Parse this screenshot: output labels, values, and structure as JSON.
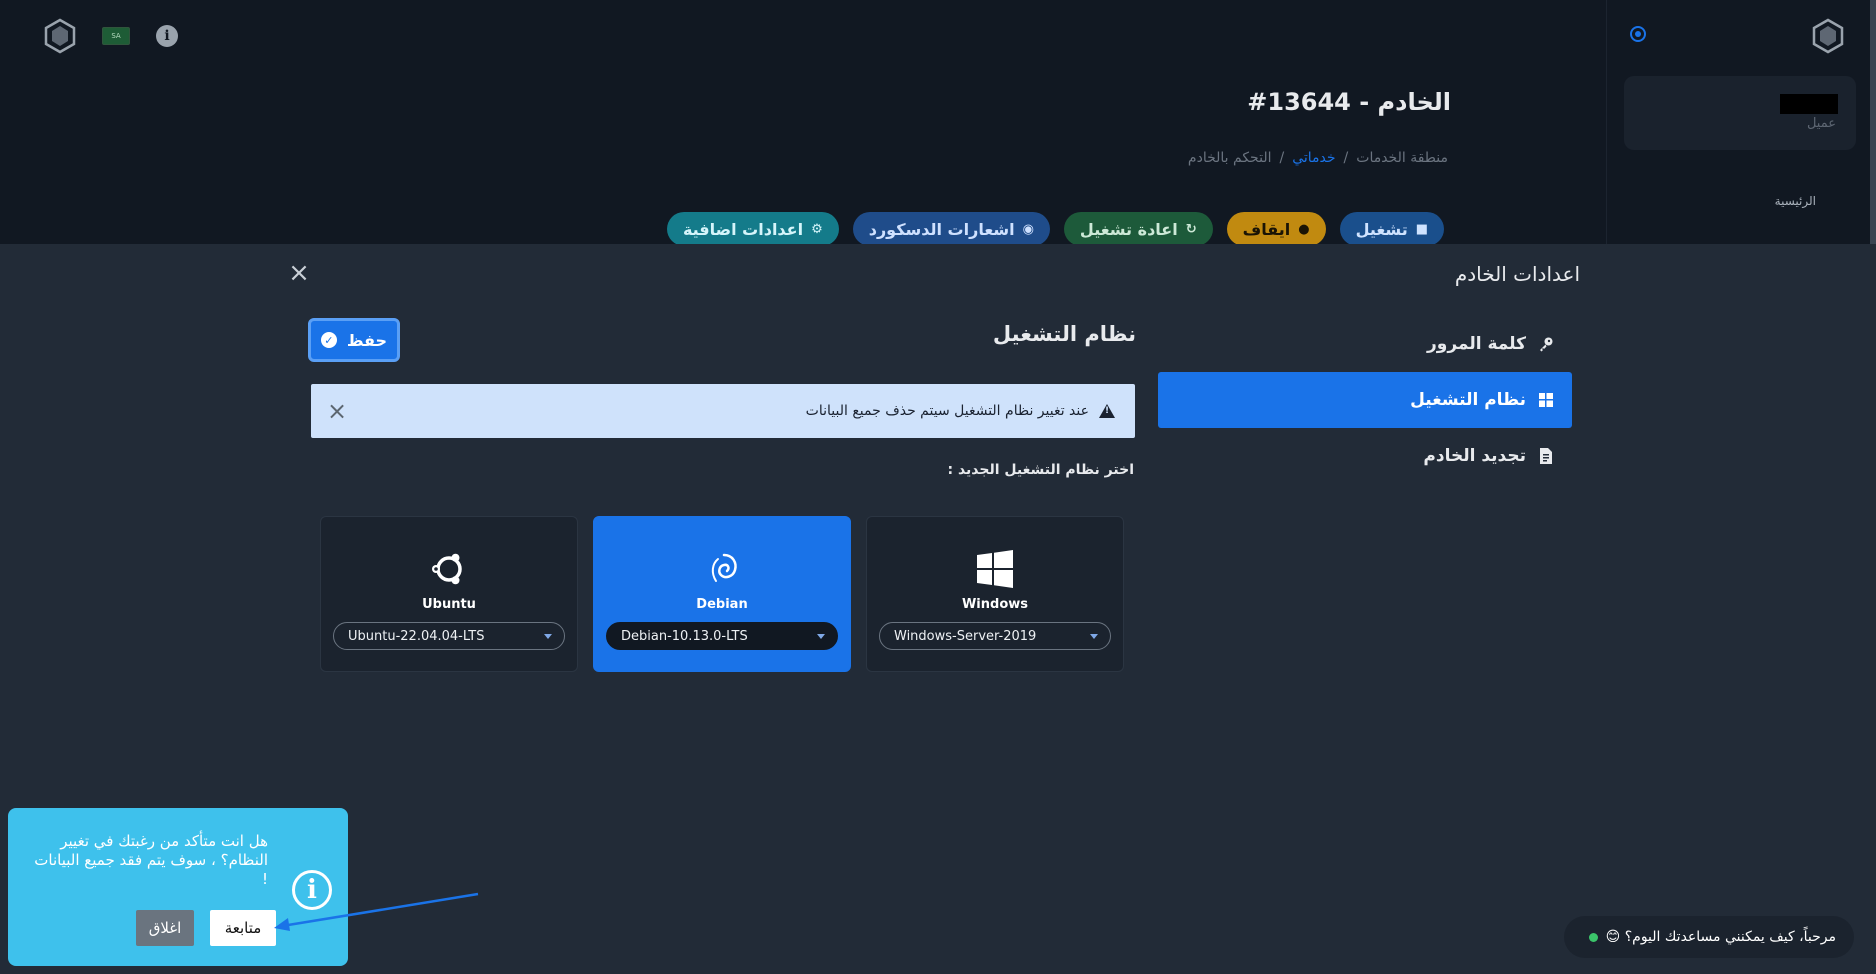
{
  "page": {
    "title": "الخادم - 13644#",
    "breadcrumb": [
      "منطقة الخدمات",
      "/",
      "خدماتي",
      "/",
      "التحكم بالخادم"
    ],
    "actions": {
      "start": "تشغيل",
      "stop": "ايقاف",
      "restart": "اعادة تشغيل",
      "discord": "اشعارات الدسكورد",
      "extra": "اعدادات اضافية"
    }
  },
  "sidebar": {
    "client_label": "عميل",
    "home": "الرئيسية"
  },
  "top": {
    "flag_text": "SA"
  },
  "modal": {
    "title": "اعدادات الخادم",
    "close": "×",
    "menu": [
      {
        "label": "كلمة المرور",
        "icon": "key-icon"
      },
      {
        "label": "نظام التشغيل",
        "icon": "windows-icon",
        "active": true
      },
      {
        "label": "تجديد الخادم",
        "icon": "invoice-icon"
      }
    ],
    "os_title": "نظام التشغيل",
    "save": "حفظ",
    "alert": "عند تغيير نظام التشغيل سيتم حذف جميع البيانات",
    "alert_close": "×",
    "choose_label": "اختر نظام التشغيل الجديد :",
    "os_options": [
      {
        "name": "Ubuntu",
        "version": "Ubuntu-22.04.04-LTS",
        "selected": false
      },
      {
        "name": "Debian",
        "version": "Debian-10.13.0-LTS",
        "selected": true
      },
      {
        "name": "Windows",
        "version": "Windows-Server-2019",
        "selected": false
      }
    ]
  },
  "popup": {
    "message": "هل انت متأكد من رغبتك في تغيير النظام؟ ، سوف يتم فقد جميع البيانات !",
    "continue": "متابعة",
    "close": "اغلاق"
  },
  "chat": {
    "text": "مرحباً، كيف يمكنني مساعدتك اليوم؟ 😊"
  },
  "colors": {
    "accent": "#1a73e8",
    "popup": "#3ec1ec"
  }
}
